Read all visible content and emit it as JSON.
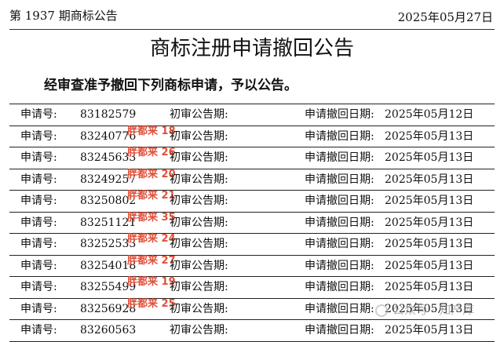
{
  "header": {
    "issue": "第 1937 期商标公告",
    "date": "2025年05月27日"
  },
  "title": "商标注册申请撤回公告",
  "intro": "经审查准予撤回下列商标申请，予以公告。",
  "labels": {
    "application_number": "申请号:",
    "preliminary_date": "初审公告期:",
    "withdrawal_date": "申请撤回日期:"
  },
  "records": [
    {
      "app_no_label": "申请号:",
      "app_no": "83182579",
      "mark": "",
      "prelim_label": "初审公告期:",
      "withdraw_label": "申请撤回日期:",
      "withdraw_date": "2025年05月12日"
    },
    {
      "app_no_label": "申请号:",
      "app_no": "83240776",
      "mark": "胖都来 18",
      "prelim_label": "初审公告期:",
      "withdraw_label": "申请撤回日期:",
      "withdraw_date": "2025年05月13日"
    },
    {
      "app_no_label": "申请号:",
      "app_no": "83245633",
      "mark": "胖都来 26",
      "prelim_label": "初审公告期:",
      "withdraw_label": "申请撤回日期:",
      "withdraw_date": "2025年05月13日"
    },
    {
      "app_no_label": "申请号:",
      "app_no": "83249257",
      "mark": "胖都来 20",
      "prelim_label": "初审公告期:",
      "withdraw_label": "申请撤回日期:",
      "withdraw_date": "2025年05月13日"
    },
    {
      "app_no_label": "申请号:",
      "app_no": "83250802",
      "mark": "胖都来 21",
      "prelim_label": "初审公告期:",
      "withdraw_label": "申请撤回日期:",
      "withdraw_date": "2025年05月13日"
    },
    {
      "app_no_label": "申请号:",
      "app_no": "83251121",
      "mark": "胖都来 35",
      "prelim_label": "初审公告期:",
      "withdraw_label": "申请撤回日期:",
      "withdraw_date": "2025年05月13日"
    },
    {
      "app_no_label": "申请号:",
      "app_no": "83252533",
      "mark": "胖都来 24",
      "prelim_label": "初审公告期:",
      "withdraw_label": "申请撤回日期:",
      "withdraw_date": "2025年05月13日"
    },
    {
      "app_no_label": "申请号:",
      "app_no": "83254018",
      "mark": "胖都来 27",
      "prelim_label": "初审公告期:",
      "withdraw_label": "申请撤回日期:",
      "withdraw_date": "2025年05月13日"
    },
    {
      "app_no_label": "申请号:",
      "app_no": "83255499",
      "mark": "胖都来 19",
      "prelim_label": "初审公告期:",
      "withdraw_label": "申请撤回日期:",
      "withdraw_date": "2025年05月13日"
    },
    {
      "app_no_label": "申请号:",
      "app_no": "83256928",
      "mark": "胖都来 25",
      "prelim_label": "初审公告期:",
      "withdraw_label": "申请撤回日期:",
      "withdraw_date": "2025年05月13日"
    },
    {
      "app_no_label": "申请号:",
      "app_no": "83260563",
      "mark": "",
      "prelim_label": "初审公告期:",
      "withdraw_label": "申请撤回日期:",
      "withdraw_date": "2025年05月13日"
    }
  ],
  "watermark": {
    "icon": "wechat-icon",
    "text": "公众号 · 知产库"
  }
}
